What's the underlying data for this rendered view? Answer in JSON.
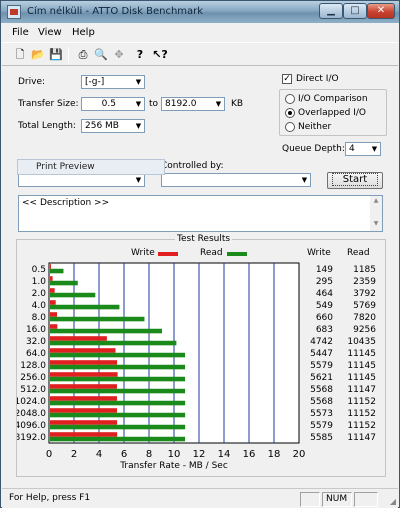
{
  "window": {
    "title": "Cím nélküli - ATTO Disk Benchmark"
  },
  "menu": {
    "file": "File",
    "view": "View",
    "help": "Help"
  },
  "toolbar": {
    "icons": [
      "new-file-icon",
      "open-folder-icon",
      "save-icon",
      "print-icon",
      "print-preview-icon",
      "move-icon",
      "help-icon",
      "context-help-icon"
    ]
  },
  "settings": {
    "drive_label": "Drive:",
    "drive_value": "[-g-]",
    "transfer_size_label": "Transfer Size:",
    "transfer_from": "0.5",
    "to_label": "to",
    "transfer_to": "8192.0",
    "kb_label": "KB",
    "total_length_label": "Total Length:",
    "total_length_value": "256 MB",
    "direct_io_label": "Direct I/O",
    "direct_io_checked": true,
    "io_comparison_label": "I/O Comparison",
    "overlapped_io_label": "Overlapped I/O",
    "neither_label": "Neither",
    "selected_io_mode": "Overlapped I/O",
    "queue_depth_label": "Queue Depth:",
    "queue_depth_value": "4",
    "controlled_by_label": "Controlled by:",
    "tooltip": "Print Preview",
    "start_label": "Start",
    "description": "<< Description >>"
  },
  "results": {
    "title": "Test Results",
    "write_legend": "Write",
    "read_legend": "Read",
    "write_col": "Write",
    "read_col": "Read",
    "write_color": "#e02020",
    "read_color": "#1a8a1a"
  },
  "chart_data": {
    "type": "bar",
    "title": "Test Results",
    "xlabel": "Transfer Rate - MB / Sec",
    "xlim": [
      0,
      20
    ],
    "xticks": [
      0,
      2,
      4,
      6,
      8,
      10,
      12,
      14,
      16,
      18,
      20
    ],
    "categories": [
      "0.5",
      "1.0",
      "2.0",
      "4.0",
      "8.0",
      "16.0",
      "32.0",
      "64.0",
      "128.0",
      "256.0",
      "512.0",
      "1024.0",
      "2048.0",
      "4096.0",
      "8192.0"
    ],
    "series": [
      {
        "name": "Write",
        "values": [
          149,
          295,
          464,
          549,
          660,
          683,
          4742,
          5447,
          5579,
          5621,
          5568,
          5568,
          5573,
          5579,
          5585
        ]
      },
      {
        "name": "Read",
        "values": [
          1185,
          2359,
          3792,
          5769,
          7820,
          9256,
          10435,
          11145,
          11145,
          11145,
          11147,
          11152,
          11152,
          11152,
          11147
        ]
      }
    ],
    "legend": "top"
  },
  "status": {
    "help_text": "For Help, press F1",
    "num": "NUM"
  }
}
